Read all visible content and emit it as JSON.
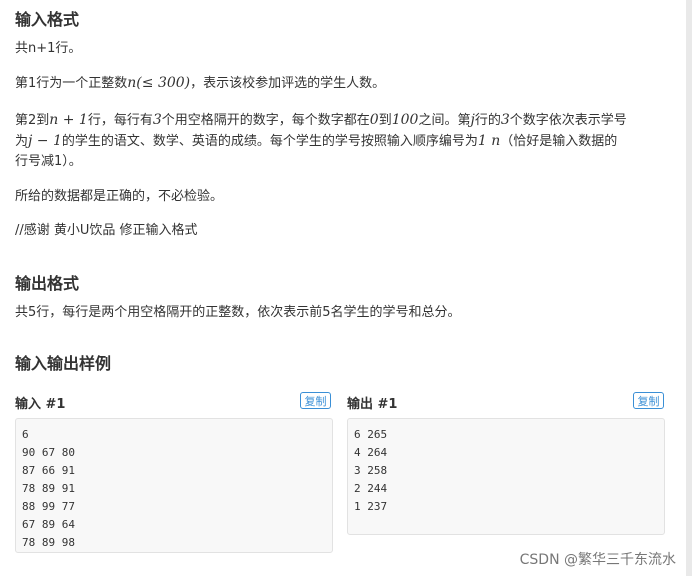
{
  "sections": {
    "input_title": "输入格式",
    "output_title": "输出格式",
    "sample_title": "输入输出样例"
  },
  "input_format": {
    "line1": "共n+1行。",
    "line2_pre": "第1行为一个正整数",
    "line2_math": "n(≤ 300)",
    "line2_post": "，表示该校参加评选的学生人数。",
    "p3_a": "第2到",
    "p3_m1": "n + 1",
    "p3_b": "行，每行有",
    "p3_m2": "3",
    "p3_c": "个用空格隔开的数字，每个数字都在",
    "p3_m3": "0",
    "p3_d": "到",
    "p3_m4": "100",
    "p3_e": "之间。第",
    "p3_m5": "j",
    "p3_f": "行的",
    "p3_m6": "3",
    "p3_g": "个数字依次表示学号",
    "p3_h": "为",
    "p3_m7": "j − 1",
    "p3_i": "的学生的语文、数学、英语的成绩。每个学生的学号按照输入顺序编号为",
    "p3_m8": "1 n",
    "p3_j": "（恰好是输入数据的",
    "p3_k": "行号减1）。",
    "line4": "所给的数据都是正确的，不必检验。",
    "line5": "//感谢 黄小U饮品 修正输入格式"
  },
  "output_format": {
    "line1": "共5行，每行是两个用空格隔开的正整数，依次表示前5名学生的学号和总分。"
  },
  "samples": {
    "input_label": "输入 #1",
    "output_label": "输出 #1",
    "copy_label": "复制",
    "input_lines": [
      "6",
      "90 67 80",
      "87 66 91",
      "78 89 91",
      "88 99 77",
      "67 89 64",
      "78 89 98"
    ],
    "output_lines": [
      "6 265",
      "4 264",
      "3 258",
      "2 244",
      "1 237"
    ]
  },
  "watermark": "CSDN @繁华三千东流水"
}
